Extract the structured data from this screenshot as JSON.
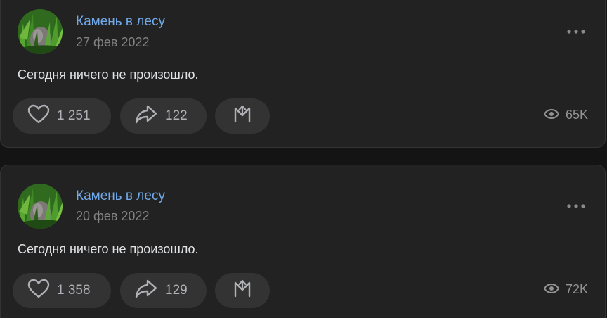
{
  "colors": {
    "background": "#141414",
    "card": "#222222",
    "author_link": "#71aaeb",
    "muted_text": "#828282",
    "post_text": "#e1e3e6",
    "button_bg": "#333333"
  },
  "posts": [
    {
      "author": "Камень в лесу",
      "date": "27 фев 2022",
      "text": "Сегодня ничего не произошло.",
      "likes": "1 251",
      "shares": "122",
      "views": "65K",
      "icons": {
        "avatar": "stone-in-grass-photo",
        "more": "more-dots-icon",
        "like": "heart-icon",
        "share": "share-arrow-icon",
        "save": "bookmark-icon",
        "views": "eye-icon"
      }
    },
    {
      "author": "Камень в лесу",
      "date": "20 фев 2022",
      "text": "Сегодня ничего не произошло.",
      "likes": "1 358",
      "shares": "129",
      "views": "72K",
      "icons": {
        "avatar": "stone-in-grass-photo",
        "more": "more-dots-icon",
        "like": "heart-icon",
        "share": "share-arrow-icon",
        "save": "bookmark-icon",
        "views": "eye-icon"
      }
    }
  ]
}
